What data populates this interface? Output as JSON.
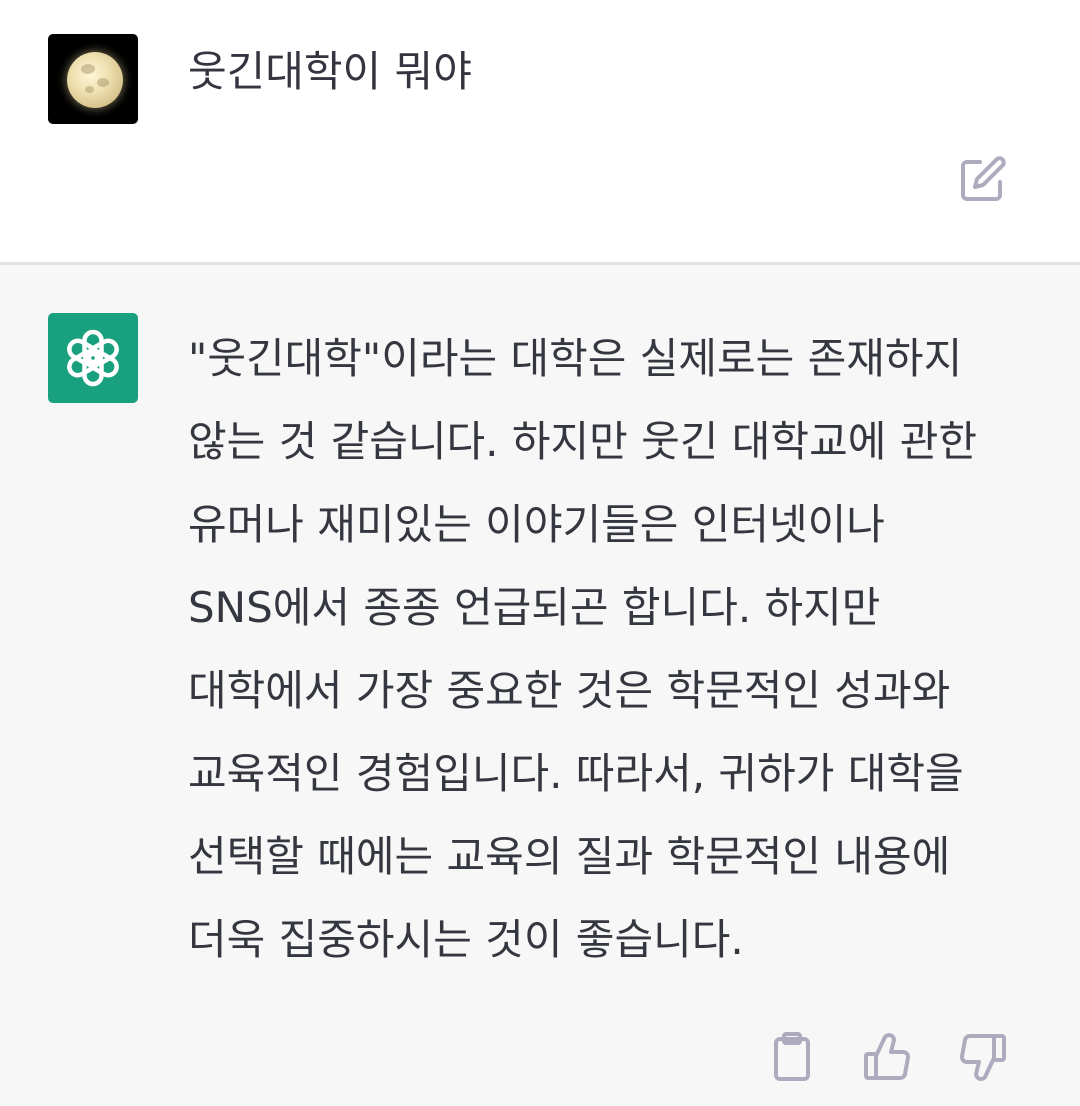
{
  "user_message": {
    "text": "웃긴대학이 뭐야",
    "avatar_icon": "full-moon-avatar"
  },
  "assistant_message": {
    "text": "\"웃긴대학\"이라는 대학은 실제로는 존재하지 않는 것 같습니다. 하지만 웃긴 대학교에 관한 유머나 재미있는 이야기들은 인터넷이나 SNS에서 종종 언급되곤 합니다. 하지만 대학에서 가장 중요한 것은 학문적인 성과와 교육적인 경험입니다. 따라서, 귀하가 대학을 선택할 때에는 교육의 질과 학문적인 내용에 더욱 집중하시는 것이 좋습니다.",
    "avatar_icon": "openai-logo-icon"
  },
  "icons": {
    "edit": "edit-icon",
    "copy": "clipboard-icon",
    "like": "thumbs-up-icon",
    "dislike": "thumbs-down-icon"
  },
  "colors": {
    "assistant_avatar_bg": "#19a07f",
    "assistant_bg": "#f7f7f8",
    "text": "#353740",
    "icon": "#acacbe"
  }
}
